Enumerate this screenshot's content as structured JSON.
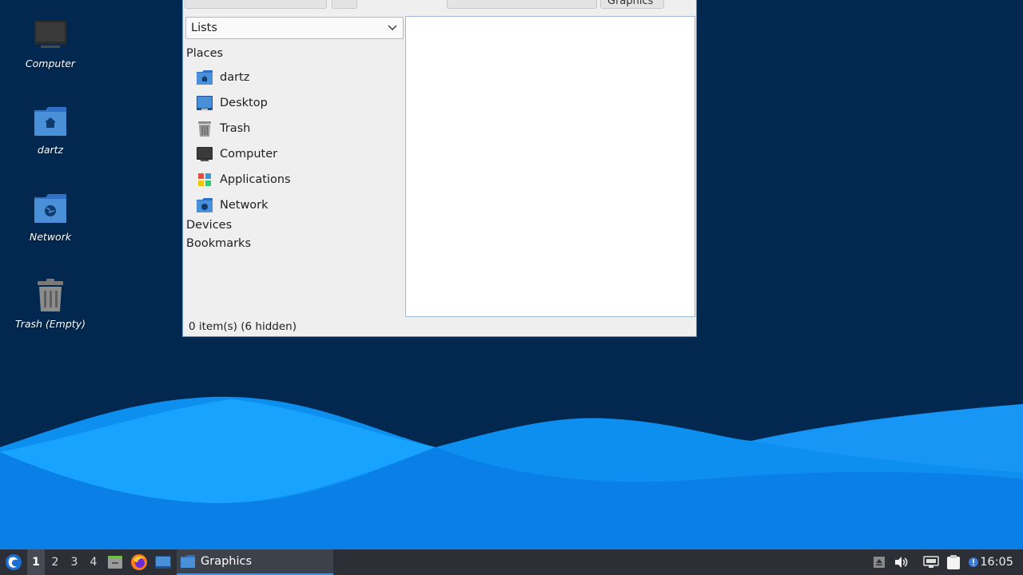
{
  "desktop": {
    "icons": [
      {
        "label": "Computer",
        "icon": "computer-icon"
      },
      {
        "label": "dartz",
        "icon": "home-folder-icon"
      },
      {
        "label": "Network",
        "icon": "network-folder-icon"
      },
      {
        "label": "Trash (Empty)",
        "icon": "trash-icon"
      }
    ]
  },
  "window": {
    "toolbar": {
      "partial_button_label": "Graphics"
    },
    "side_pane_mode": "Lists",
    "sections": {
      "places": "Places",
      "devices": "Devices",
      "bookmarks": "Bookmarks"
    },
    "places": [
      {
        "label": "dartz",
        "icon": "home-folder-icon"
      },
      {
        "label": "Desktop",
        "icon": "desktop-icon"
      },
      {
        "label": "Trash",
        "icon": "trash-icon"
      },
      {
        "label": "Computer",
        "icon": "computer-icon"
      },
      {
        "label": "Applications",
        "icon": "applications-icon"
      },
      {
        "label": "Network",
        "icon": "network-folder-icon"
      }
    ],
    "status": "0 item(s) (6 hidden)"
  },
  "taskbar": {
    "workspaces": [
      "1",
      "2",
      "3",
      "4"
    ],
    "active_workspace": "1",
    "task_label": "Graphics",
    "clock": "16:05"
  },
  "colors": {
    "accent": "#4a90d9",
    "desktop_bg": "#03284f",
    "wave_light": "#1aa2ff",
    "wave_mid": "#0a7fe6"
  }
}
